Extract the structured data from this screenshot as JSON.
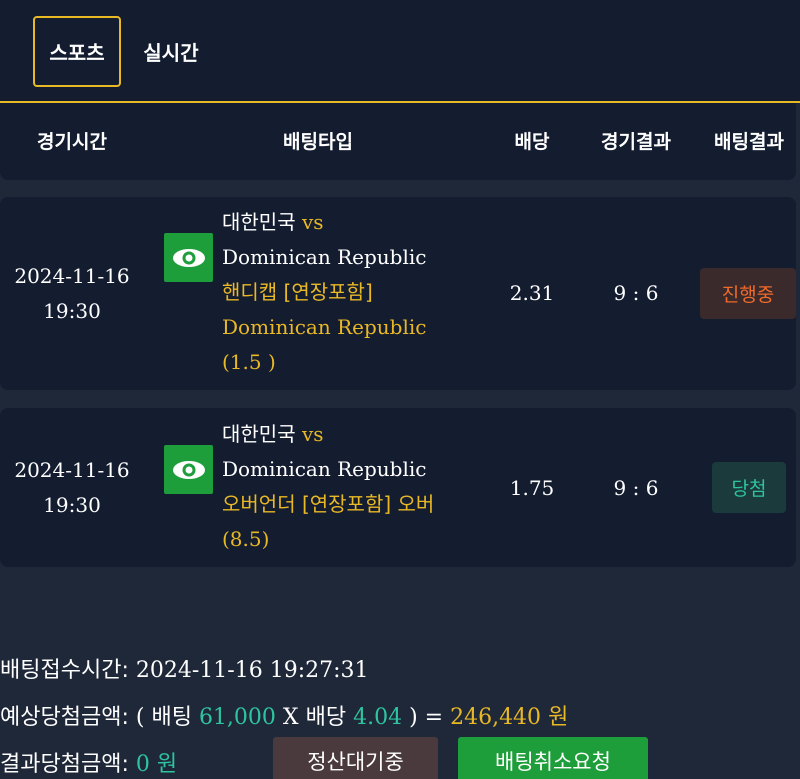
{
  "tabs": [
    {
      "label": "스포츠",
      "active": true
    },
    {
      "label": "실시간",
      "active": false
    }
  ],
  "columns": {
    "time": "경기시간",
    "bet_type": "배팅타입",
    "odds": "배당",
    "game_result": "경기결과",
    "bet_result": "배팅결과"
  },
  "bets": [
    {
      "date": "2024-11-16",
      "time": "19:30",
      "team_home": "대한민국",
      "vs": "vs",
      "team_away": "Dominican Republic",
      "market": "핸디캡 [연장포함]",
      "pick": "Dominican Republic",
      "line": "(1.5 )",
      "odds": "2.31",
      "score": "9 : 6",
      "status": "진행중",
      "status_color": "#f06a2a"
    },
    {
      "date": "2024-11-16",
      "time": "19:30",
      "team_home": "대한민국",
      "vs": "vs",
      "team_away": "Dominican Republic",
      "market": "오버언더 [연장포함] 오버",
      "line": "(8.5)",
      "odds": "1.75",
      "score": "9 : 6",
      "status": "당첨",
      "status_color": "#2ec4a0"
    }
  ],
  "summary": {
    "received_label": "배팅접수시간:",
    "received_value": "2024-11-16 19:27:31",
    "expected_label": "예상당첨금액:",
    "open_paren": "(",
    "bet_label": "배팅",
    "bet_amount": "61,000",
    "times": "X",
    "odds_label": "배당",
    "total_odds": "4.04",
    "close_eq": ") =",
    "expected_amount": "246,440",
    "won": "원",
    "result_label": "결과당첨금액:",
    "result_amount": "0",
    "result_won": "원"
  },
  "buttons": {
    "settle": "정산대기중",
    "cancel": "배팅취소요청"
  },
  "colors": {
    "accent": "#e9b825",
    "highlight_green": "#2ec4a0",
    "button_green": "#1e9e3a"
  }
}
